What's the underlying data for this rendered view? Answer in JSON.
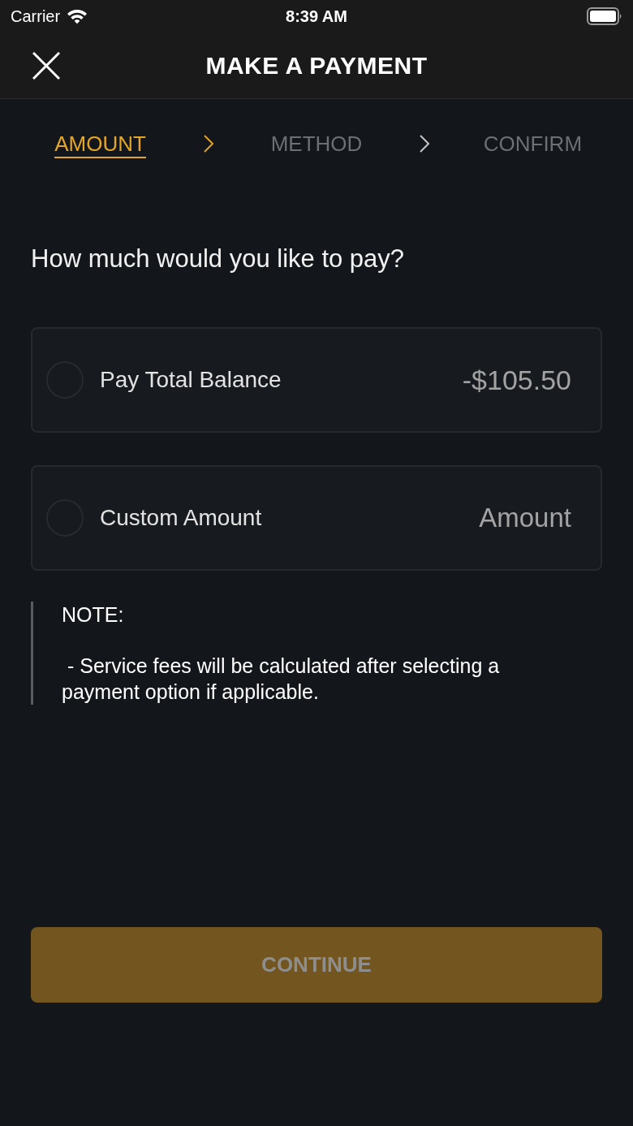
{
  "status_bar": {
    "carrier": "Carrier",
    "time": "8:39 AM"
  },
  "header": {
    "title": "MAKE A PAYMENT"
  },
  "steps": [
    {
      "label": "AMOUNT",
      "selected": true
    },
    {
      "label": "METHOD",
      "selected": false
    },
    {
      "label": "CONFIRM",
      "selected": false
    }
  ],
  "question": "How much would you like to pay?",
  "options": [
    {
      "kind": "value",
      "label": "Pay Total Balance",
      "selected": false,
      "value": "-$105.50"
    },
    {
      "kind": "input",
      "label": "Custom Amount",
      "selected": false,
      "placeholder": "Amount"
    }
  ],
  "note": {
    "title": "NOTE:",
    "text": " - Service fees will be calculated after selecting a payment option if applicable."
  },
  "continue_button": {
    "label": "CONTINUE",
    "disabled": true
  }
}
